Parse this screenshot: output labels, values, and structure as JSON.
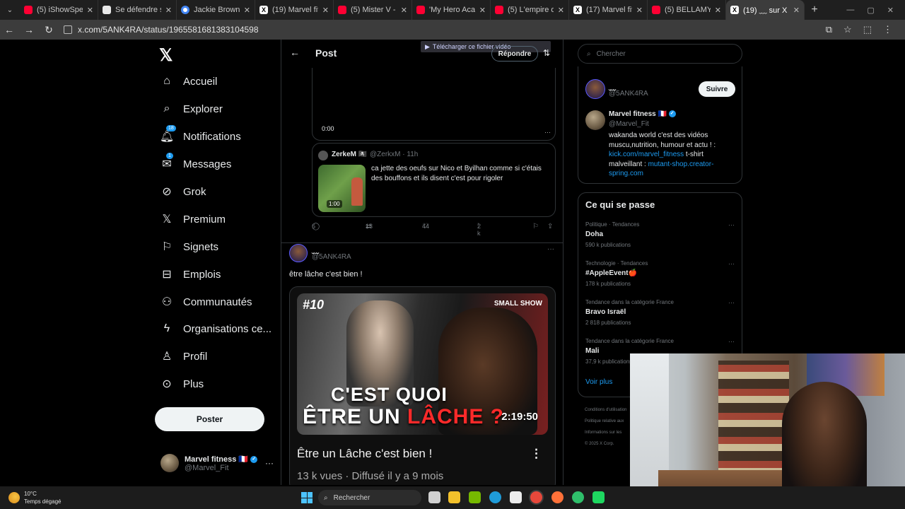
{
  "browser": {
    "tabs": [
      {
        "label": "(5) iShowSpeed g",
        "icon": "youtube-icon"
      },
      {
        "label": "Se défendre sans",
        "icon": "doc-icon"
      },
      {
        "label": "Jackie Brown - Re",
        "icon": "google-icon"
      },
      {
        "label": "(19) Marvel fitnes",
        "icon": "x-icon"
      },
      {
        "label": "(5) Mister V - You",
        "icon": "youtube-icon"
      },
      {
        "label": "'My Hero Academ",
        "icon": "youtube-icon"
      },
      {
        "label": "(5) L'empire du d",
        "icon": "youtube-icon"
      },
      {
        "label": "(17) Marvel fitnes",
        "icon": "x-icon"
      },
      {
        "label": "(5) BELLAMY hum",
        "icon": "youtube-icon"
      },
      {
        "label": "(19) ﹏ sur X : \"@",
        "icon": "x-icon",
        "active": true
      }
    ],
    "url": "x.com/5ANK4RA/status/1965581681383104598"
  },
  "leftnav": {
    "items": [
      {
        "label": "Accueil",
        "icon": "home-icon"
      },
      {
        "label": "Explorer",
        "icon": "search-icon"
      },
      {
        "label": "Notifications",
        "icon": "bell-icon",
        "badge": "18"
      },
      {
        "label": "Messages",
        "icon": "mail-icon",
        "badge": "1"
      },
      {
        "label": "Grok",
        "icon": "grok-icon"
      },
      {
        "label": "Premium",
        "icon": "x-icon"
      },
      {
        "label": "Signets",
        "icon": "bookmark-icon"
      },
      {
        "label": "Emplois",
        "icon": "briefcase-icon"
      },
      {
        "label": "Communautés",
        "icon": "communities-icon"
      },
      {
        "label": "Organisations ce...",
        "icon": "lightning-icon"
      },
      {
        "label": "Profil",
        "icon": "person-icon"
      },
      {
        "label": "Plus",
        "icon": "more-circle-icon"
      }
    ],
    "post_button": "Poster",
    "account": {
      "name": "Marvel fitness 🇫🇷",
      "handle": "@Marvel_Fit"
    }
  },
  "main": {
    "header_title": "Post",
    "reply_button": "Répondre",
    "download_overlay": "Télécharger ce fichier vidéo",
    "video_time": "0:00",
    "quote": {
      "name": "ZerkeM 🏴‍☠️",
      "handle_time": "@ZerkxM · 11h",
      "text": "ca jette des oeufs sur Nico et Byilhan comme si c'étais des bouffons et ils disent c'est pour rigoler",
      "duration": "1:00"
    },
    "actions": {
      "replies": "6",
      "reposts": "13",
      "likes": "44",
      "views": "2 k"
    },
    "reply": {
      "name": "﹏",
      "handle": "@5ANK4RA",
      "text": "être lâche c'est bien !",
      "youtube": {
        "thumb_number": "#10",
        "thumb_brand": "SMALL SHOW",
        "thumb_line1": "C'EST QUOI",
        "thumb_line2a": "ÊTRE UN ",
        "thumb_line2b": "LÂCHE ?",
        "duration": "2:19:50",
        "title": "Être un Lâche c'est bien !",
        "meta": "13 k vues · Diffusé il y a 9 mois"
      }
    }
  },
  "right": {
    "search_placeholder": "Chercher",
    "profiles": {
      "user1": {
        "name": "﹏",
        "handle": "@5ANK4RA",
        "follow_label": "Suivre"
      },
      "user2": {
        "name": "Marvel fitness 🇫🇷",
        "handle": "@Marvel_Fit",
        "bio_a": "wakanda world c'est des vidéos muscu,nutrition, humour et actu ! : ",
        "bio_link1": "kick.com/marvel_fitness",
        "bio_b": " t-shirt malveillant : ",
        "bio_link2": "mutant-shop.creator-spring.com"
      }
    },
    "trends": {
      "heading": "Ce qui se passe",
      "items": [
        {
          "context": "Politique · Tendances",
          "title": "Doha",
          "count": "590 k publications"
        },
        {
          "context": "Technologie · Tendances",
          "title": "#AppleEvent🍎",
          "count": "178 k publications"
        },
        {
          "context": "Tendance dans la catégorie France",
          "title": "Bravo Israël",
          "count": "2 818 publications"
        },
        {
          "context": "Tendance dans la catégorie France",
          "title": "Mali",
          "count": "37,9 k publications"
        }
      ],
      "show_more": "Voir plus"
    },
    "footer": [
      "Conditions d'utilisation",
      "Politique relative aux",
      "Informations sur les",
      "© 2025 X Corp."
    ]
  },
  "taskbar": {
    "temp": "10°C",
    "weather": "Temps dégagé",
    "search_label": "Rechercher"
  },
  "colors": {
    "accent": "#1d9bf0",
    "background": "#000000",
    "border": "#2f3336"
  }
}
